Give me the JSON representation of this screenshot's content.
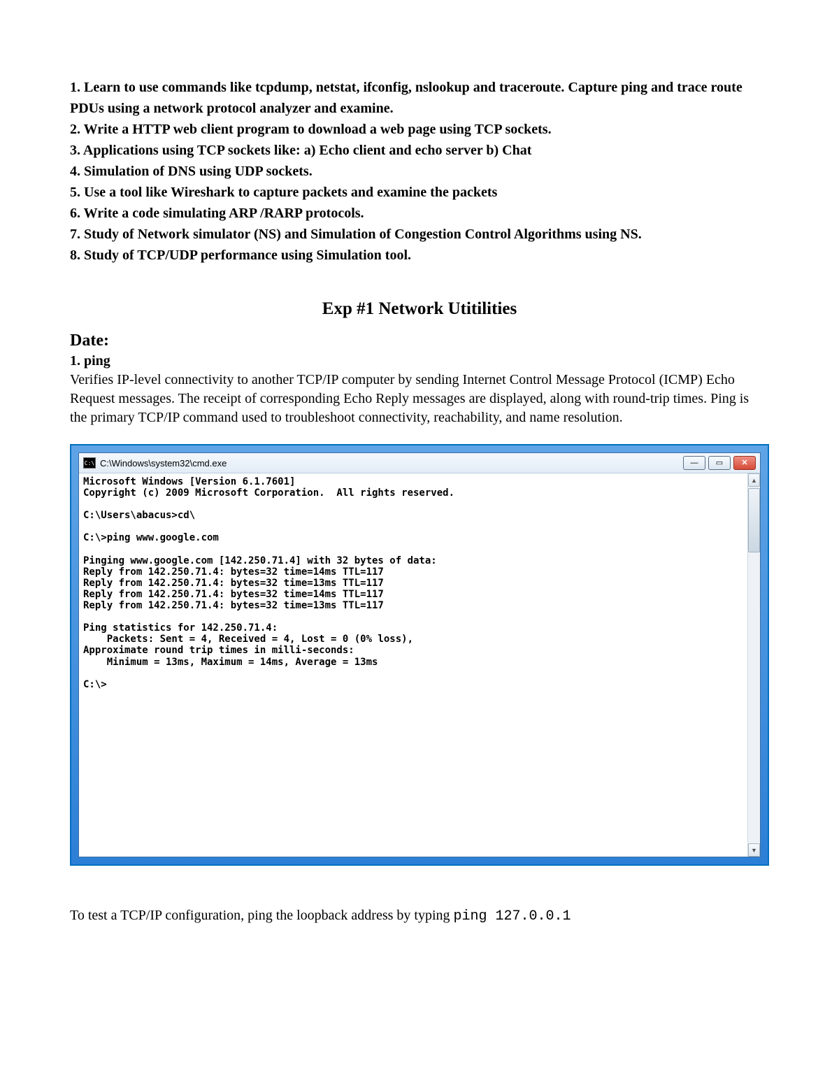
{
  "experiments": [
    "1. Learn to use commands like tcpdump, netstat, ifconfig, nslookup and traceroute. Capture ping and trace route PDUs using a network protocol analyzer and examine.",
    "2. Write a HTTP web client program to download a web page using TCP sockets.",
    "3. Applications using TCP sockets like: a) Echo client and echo server b) Chat",
    "4. Simulation of DNS using UDP sockets.",
    "5. Use a tool like Wireshark to capture packets and examine the packets",
    "6. Write a code simulating ARP /RARP protocols.",
    "7. Study of Network simulator (NS) and Simulation of Congestion Control Algorithms using NS.",
    "8. Study of TCP/UDP performance using Simulation tool."
  ],
  "heading": "Exp #1 Network Utitilities",
  "date_label": "Date:",
  "ping_head": "1. ping",
  "ping_desc": "Verifies IP-level connectivity to another TCP/IP computer by sending Internet Control Message Protocol (ICMP) Echo Request messages. The receipt of corresponding Echo Reply messages are displayed, along with round-trip times. Ping is the primary TCP/IP command used to troubleshoot connectivity, reachability, and name resolution.",
  "window_title": "C:\\Windows\\system32\\cmd.exe",
  "console_output": "Microsoft Windows [Version 6.1.7601]\nCopyright (c) 2009 Microsoft Corporation.  All rights reserved.\n\nC:\\Users\\abacus>cd\\\n\nC:\\>ping www.google.com\n\nPinging www.google.com [142.250.71.4] with 32 bytes of data:\nReply from 142.250.71.4: bytes=32 time=14ms TTL=117\nReply from 142.250.71.4: bytes=32 time=13ms TTL=117\nReply from 142.250.71.4: bytes=32 time=14ms TTL=117\nReply from 142.250.71.4: bytes=32 time=13ms TTL=117\n\nPing statistics for 142.250.71.4:\n    Packets: Sent = 4, Received = 4, Lost = 0 (0% loss),\nApproximate round trip times in milli-seconds:\n    Minimum = 13ms, Maximum = 14ms, Average = 13ms\n\nC:\\>",
  "footer_text": "To test a TCP/IP configuration, ping the loopback address by typing ",
  "footer_code": "ping 127.0.0.1",
  "icons": {
    "app": "C:\\",
    "min": "—",
    "max": "▭",
    "close": "✕",
    "up": "▲",
    "down": "▼"
  }
}
